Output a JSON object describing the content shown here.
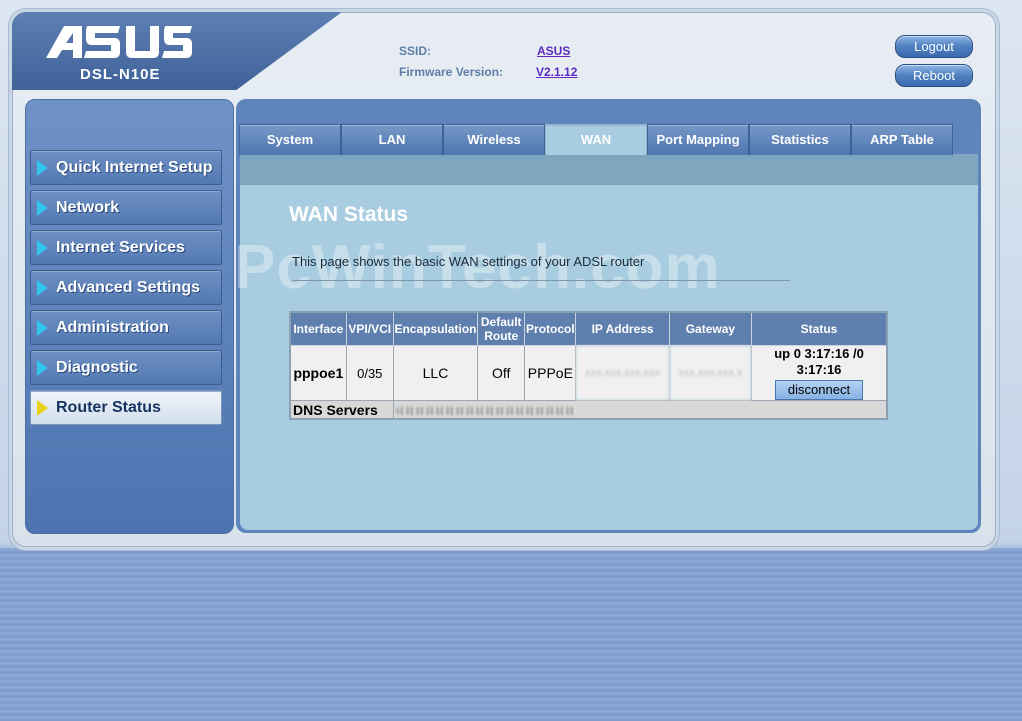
{
  "header": {
    "brand": "ASUS",
    "model": "DSL-N10E",
    "ssid_label": "SSID:",
    "ssid_value": "ASUS",
    "firmware_label": "Firmware Version:",
    "firmware_value": "V2.1.12",
    "logout_label": "Logout",
    "reboot_label": "Reboot"
  },
  "sidebar": {
    "items": [
      {
        "label": "Quick Internet Setup",
        "active": false
      },
      {
        "label": "Network",
        "active": false
      },
      {
        "label": "Internet Services",
        "active": false
      },
      {
        "label": "Advanced Settings",
        "active": false
      },
      {
        "label": "Administration",
        "active": false
      },
      {
        "label": "Diagnostic",
        "active": false
      },
      {
        "label": "Router Status",
        "active": true
      }
    ]
  },
  "tabs": [
    {
      "label": "System",
      "active": false
    },
    {
      "label": "LAN",
      "active": false
    },
    {
      "label": "Wireless",
      "active": false
    },
    {
      "label": "WAN",
      "active": true
    },
    {
      "label": "Port Mapping",
      "active": false
    },
    {
      "label": "Statistics",
      "active": false
    },
    {
      "label": "ARP Table",
      "active": false
    }
  ],
  "main": {
    "title": "WAN Status",
    "description": "This page shows the basic WAN settings of your ADSL router",
    "watermark": "PcWinTech.com"
  },
  "table": {
    "headers": [
      "Interface",
      "VPI/VCI",
      "Encapsulation",
      "Default Route",
      "Protocol",
      "IP Address",
      "Gateway",
      "Status"
    ],
    "row": {
      "interface": "pppoe1",
      "vpi_vci": "0/35",
      "encapsulation": "LLC",
      "default_route": "Off",
      "protocol": "PPPoE",
      "ip_address": "xxx.xxx.xxx.xxx",
      "gateway": "xxx.xxx.xxx.x",
      "status": "up 0 3:17:16 /0 3:17:16",
      "disconnect_label": "disconnect"
    },
    "dns_label": "DNS Servers"
  },
  "colors": {
    "sidebar_bg": "#5b80b9",
    "content_bg": "#a9cde0",
    "table_header_bg": "#5f7fae",
    "active_arrow": "#e8d21a",
    "inactive_arrow": "#35c4ef"
  }
}
